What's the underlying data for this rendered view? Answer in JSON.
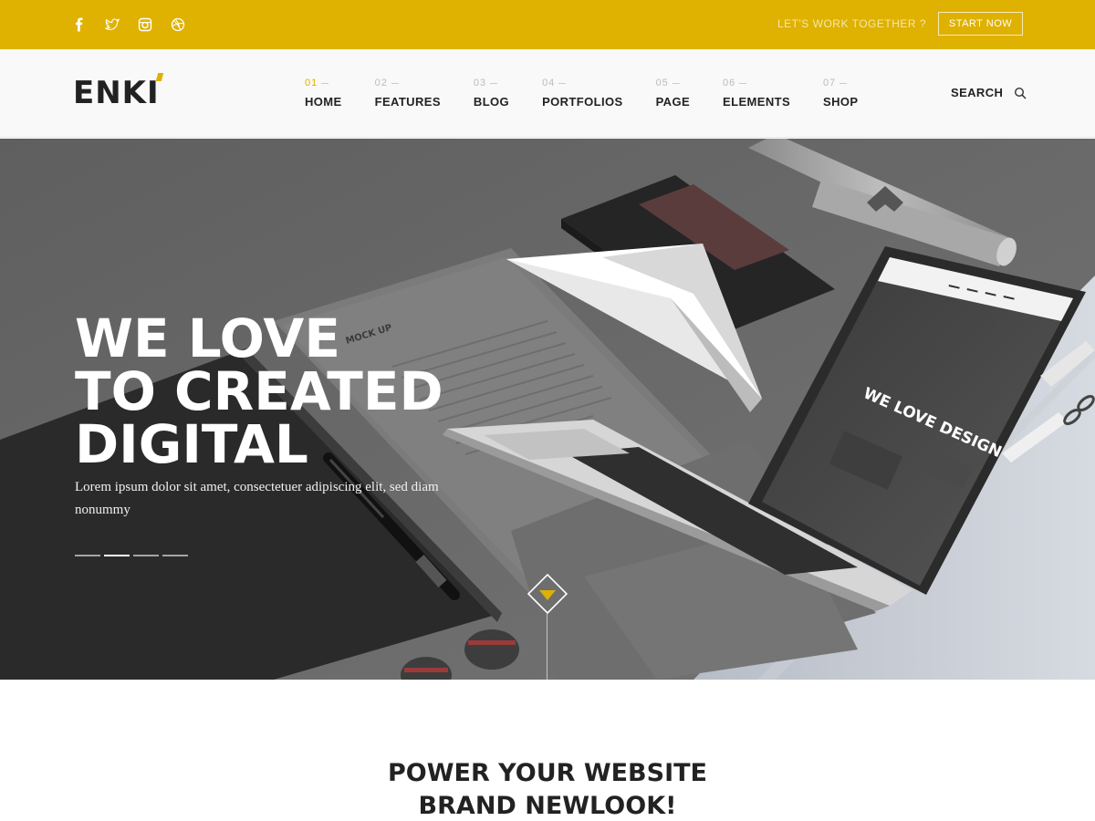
{
  "topbar": {
    "social_icons": [
      "facebook-icon",
      "twitter-icon",
      "instagram-icon",
      "dribbble-icon"
    ],
    "tagline": "LET'S WORK TOGETHER ?",
    "cta_label": "START NOW",
    "background_color": "#dfb100"
  },
  "header": {
    "logo": "ENKI",
    "nav": [
      {
        "num": "01",
        "label": "HOME",
        "active": true
      },
      {
        "num": "02",
        "label": "FEATURES"
      },
      {
        "num": "03",
        "label": "BLOG"
      },
      {
        "num": "04",
        "label": "PORTFOLIOS"
      },
      {
        "num": "05",
        "label": "PAGE"
      },
      {
        "num": "06",
        "label": "ELEMENTS"
      },
      {
        "num": "07",
        "label": "SHOP"
      }
    ],
    "search_label": "SEARCH",
    "accent_color": "#dfb100"
  },
  "hero": {
    "title_lines": [
      "WE LOVE",
      "TO CREATED",
      "DIGITAL"
    ],
    "subtitle": "Lorem ipsum dolor sit amet, consectetuer adipiscing elit, sed diam nonummy",
    "slides_count": 4,
    "active_slide": 2,
    "mockup_texts": {
      "letter_brand": "MOCK UP",
      "screen_headline": "WE LOVE DESIGN"
    }
  },
  "section": {
    "title_lines": [
      "POWER YOUR WEBSITE",
      "BRAND NEWLOOK!"
    ]
  }
}
